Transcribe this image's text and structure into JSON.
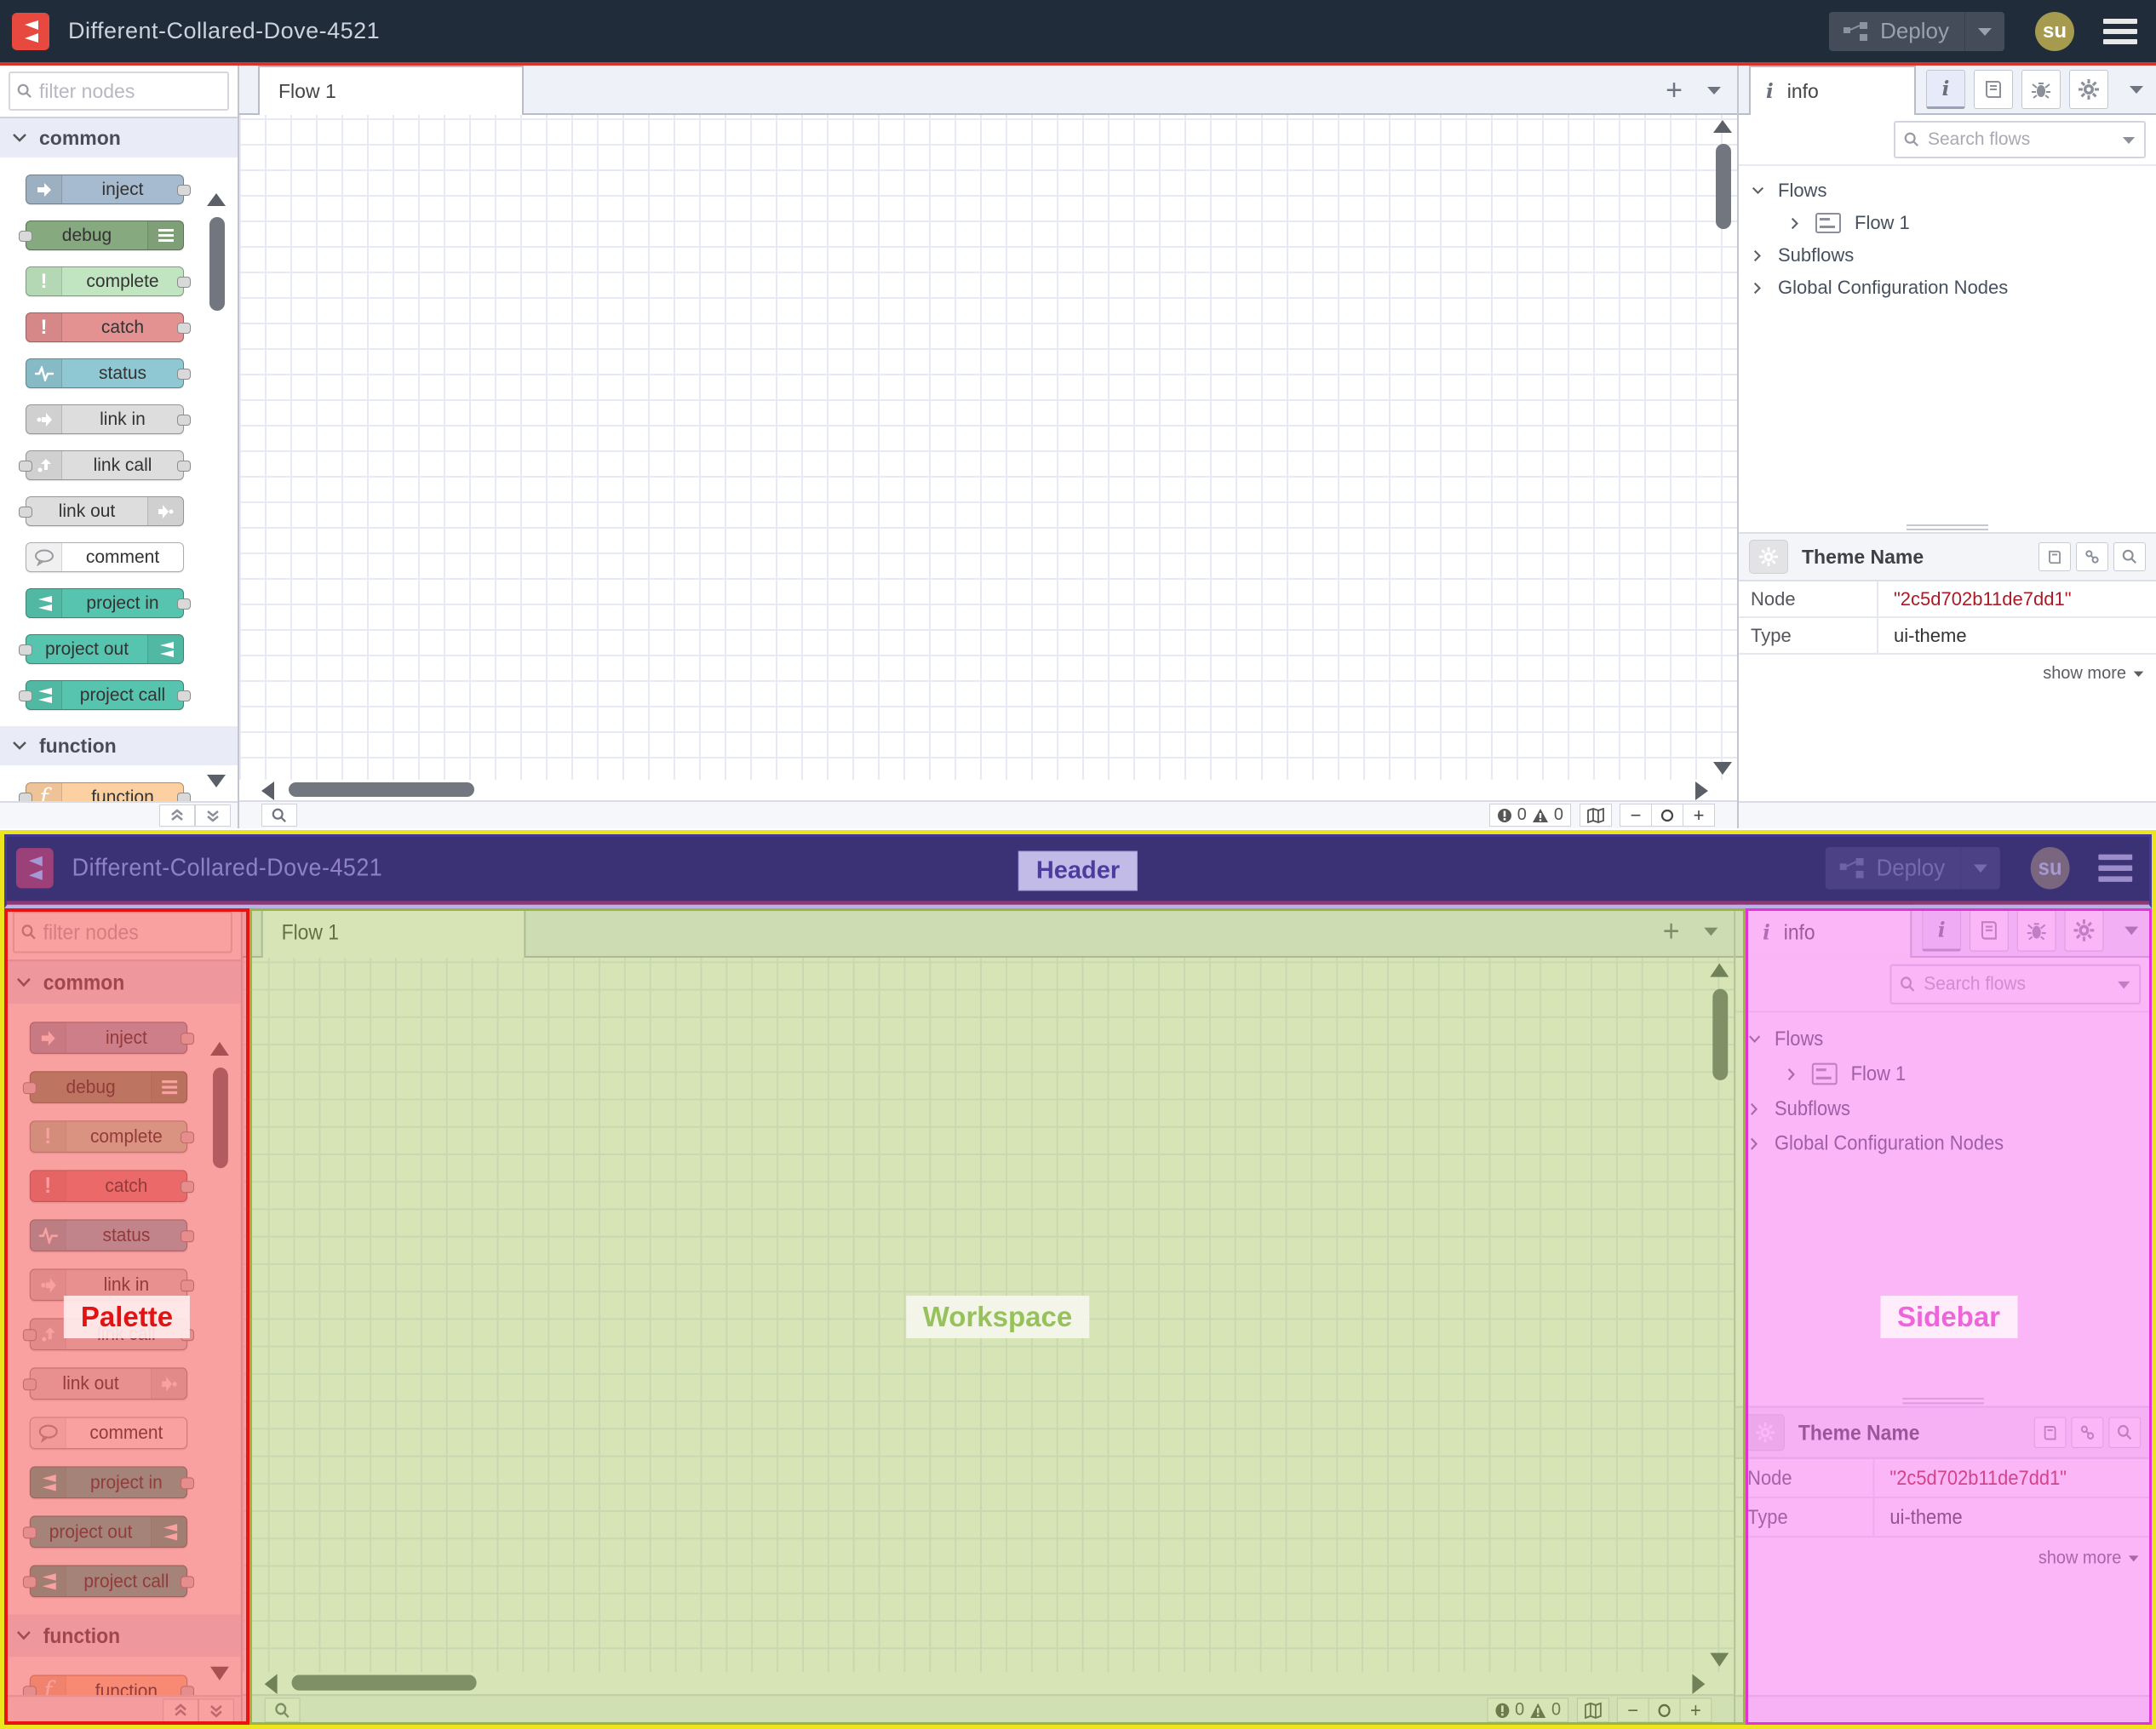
{
  "header": {
    "title": "Different-Collared-Dove-4521",
    "deploy_label": "Deploy",
    "avatar": "su"
  },
  "palette": {
    "filter_placeholder": "filter nodes",
    "categories": [
      {
        "label": "common"
      },
      {
        "label": "function"
      }
    ],
    "nodes": [
      {
        "label": "inject",
        "color": "#a6bbcf",
        "icon": "arrow-in-icon"
      },
      {
        "label": "debug",
        "color": "#87a980",
        "icon": "debug-list-icon"
      },
      {
        "label": "complete",
        "color": "#c0e5c0",
        "icon": "exclamation-icon"
      },
      {
        "label": "catch",
        "color": "#e49191",
        "icon": "exclamation-icon"
      },
      {
        "label": "status",
        "color": "#8fc7d2",
        "icon": "status-pulse-icon"
      },
      {
        "label": "link in",
        "color": "#dddddd",
        "icon": "link-icon"
      },
      {
        "label": "link call",
        "color": "#dddddd",
        "icon": "link-icon"
      },
      {
        "label": "link out",
        "color": "#dddddd",
        "icon": "link-icon"
      },
      {
        "label": "comment",
        "color": "#ffffff",
        "icon": "comment-bubble-icon"
      },
      {
        "label": "project in",
        "color": "#56c4ae",
        "icon": "project-icon"
      },
      {
        "label": "project out",
        "color": "#56c4ae",
        "icon": "project-icon"
      },
      {
        "label": "project call",
        "color": "#56c4ae",
        "icon": "project-icon"
      },
      {
        "label": "function",
        "color": "#fdd0a2",
        "icon": "function-f-icon"
      }
    ]
  },
  "workspace": {
    "tab": "Flow 1",
    "error_count": "0",
    "warning_count": "0"
  },
  "sidebar": {
    "tab": "info",
    "search_placeholder": "Search flows",
    "tree": {
      "flows": "Flows",
      "flow1": "Flow 1",
      "subflows": "Subflows",
      "global": "Global Configuration Nodes"
    },
    "theme": {
      "title": "Theme Name",
      "node_label": "Node",
      "node_value": "\"2c5d702b11de7dd1\"",
      "type_label": "Type",
      "type_value": "ui-theme",
      "show_more": "show more"
    }
  },
  "annotations": {
    "header": "Header",
    "palette": "Palette",
    "workspace": "Workspace",
    "sidebar": "Sidebar",
    "frame_color": "#ece41c",
    "header_overlay_color": "#5538ae",
    "palette_overlay_color": "#f34141",
    "workspace_overlay_color": "#96ba3e",
    "sidebar_overlay_color": "#f76ef0"
  }
}
